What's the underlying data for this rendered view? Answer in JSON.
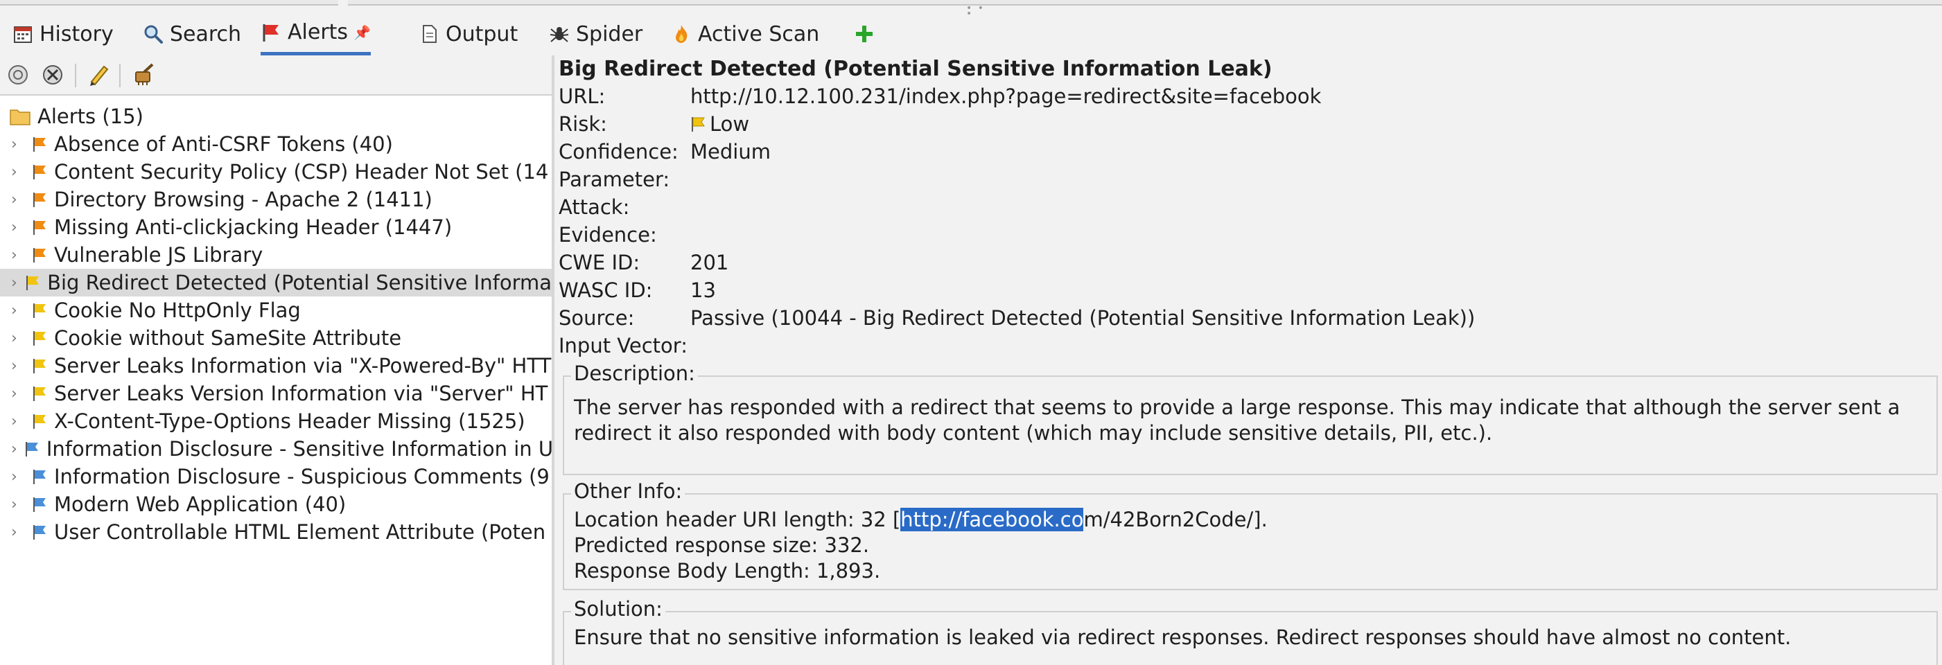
{
  "tabs": [
    {
      "label": "History",
      "icon": "calendar-icon"
    },
    {
      "label": "Search",
      "icon": "search-icon"
    },
    {
      "label": "Alerts",
      "icon": "alert-flag-icon",
      "active": true
    },
    {
      "label": "Output",
      "icon": "document-icon"
    },
    {
      "label": "Spider",
      "icon": "spider-icon"
    },
    {
      "label": "Active Scan",
      "icon": "flame-icon"
    },
    {
      "label": "",
      "icon": "add-tab-icon"
    }
  ],
  "toolbar": {
    "icons": [
      "filter-icon",
      "delete-all-icon",
      "edit-alert-icon",
      "broom-icon"
    ]
  },
  "tree": {
    "root_label": "Alerts (15)",
    "items": [
      {
        "label": "Absence of Anti-CSRF Tokens (40)",
        "risk": "medium"
      },
      {
        "label": "Content Security Policy (CSP) Header Not Set (14",
        "risk": "medium"
      },
      {
        "label": "Directory Browsing - Apache 2 (1411)",
        "risk": "medium"
      },
      {
        "label": "Missing Anti-clickjacking Header (1447)",
        "risk": "medium"
      },
      {
        "label": "Vulnerable JS Library",
        "risk": "medium"
      },
      {
        "label": "Big Redirect Detected (Potential Sensitive Informa",
        "risk": "low",
        "selected": true
      },
      {
        "label": "Cookie No HttpOnly Flag",
        "risk": "low"
      },
      {
        "label": "Cookie without SameSite Attribute",
        "risk": "low"
      },
      {
        "label": "Server Leaks Information via \"X-Powered-By\" HTT",
        "risk": "low"
      },
      {
        "label": "Server Leaks Version Information via \"Server\" HT",
        "risk": "low"
      },
      {
        "label": "X-Content-Type-Options Header Missing (1525)",
        "risk": "low"
      },
      {
        "label": "Information Disclosure - Sensitive Information in U",
        "risk": "info"
      },
      {
        "label": "Information Disclosure - Suspicious Comments (9",
        "risk": "info"
      },
      {
        "label": "Modern Web Application (40)",
        "risk": "info"
      },
      {
        "label": "User Controllable HTML Element Attribute (Poten",
        "risk": "info"
      }
    ]
  },
  "details": {
    "title": "Big Redirect Detected (Potential Sensitive Information Leak)",
    "url_label": "URL:",
    "url": "http://10.12.100.231/index.php?page=redirect&site=facebook",
    "risk_label": "Risk:",
    "risk": "Low",
    "confidence_label": "Confidence:",
    "confidence": "Medium",
    "parameter_label": "Parameter:",
    "attack_label": "Attack:",
    "evidence_label": "Evidence:",
    "cwe_label": "CWE ID:",
    "cwe": "201",
    "wasc_label": "WASC ID:",
    "wasc": "13",
    "source_label": "Source:",
    "source": "Passive (10044 - Big Redirect Detected (Potential Sensitive Information Leak))",
    "input_vector_label": "Input Vector:",
    "description_legend": "Description:",
    "description_line1": "The server has responded with a redirect that seems to provide a large response. This may indicate that although the server sent a",
    "description_line2": "redirect it also responded with body content (which may include sensitive details, PII, etc.).",
    "other_info_legend": "Other Info:",
    "other_info_line1_pre": "Location header URI length: 32 [",
    "other_info_line1_sel": "http://facebook.co",
    "other_info_line1_post": "m/42Born2Code/].",
    "other_info_line2": "Predicted response size: 332.",
    "other_info_line3": "Response Body Length: 1,893.",
    "solution_legend": "Solution:",
    "solution": "Ensure that no sensitive information is leaked via redirect responses. Redirect responses should have almost no content."
  },
  "colors": {
    "flag_medium": "#f08c12",
    "flag_low": "#f1c40f",
    "flag_info": "#4a8fd8",
    "tab_active_underline": "#3b73c2",
    "selection": "#2a6bc7"
  }
}
